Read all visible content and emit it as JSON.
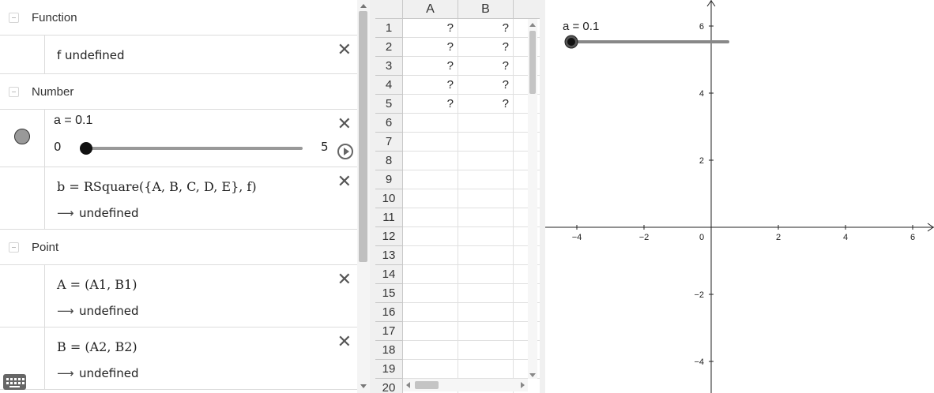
{
  "algebra": {
    "categories": {
      "function": "Function",
      "number": "Number",
      "point": "Point"
    },
    "f_row": {
      "expr": "f undefined"
    },
    "a_row": {
      "expr": "a = 0.1",
      "slider_min": "0",
      "slider_max": "5",
      "slider_value": 0.1
    },
    "b_row": {
      "expr": "b = RSquare({A, B, C, D, E}, f)",
      "output": "undefined"
    },
    "A_row": {
      "expr": "A = (A1, B1)",
      "output": "undefined"
    },
    "B_row": {
      "expr": "B = (A2, B2)",
      "output": "undefined"
    },
    "arrow": "⟶",
    "close": "✕"
  },
  "spreadsheet": {
    "columns": [
      "A",
      "B"
    ],
    "rows": [
      "1",
      "2",
      "3",
      "4",
      "5",
      "6",
      "7",
      "8",
      "9",
      "10",
      "11",
      "12",
      "13",
      "14",
      "15",
      "16",
      "17",
      "18",
      "19",
      "20"
    ],
    "cells": [
      [
        "?",
        "?"
      ],
      [
        "?",
        "?"
      ],
      [
        "?",
        "?"
      ],
      [
        "?",
        "?"
      ],
      [
        "?",
        "?"
      ],
      [
        "",
        ""
      ],
      [
        "",
        ""
      ],
      [
        "",
        ""
      ],
      [
        "",
        ""
      ],
      [
        "",
        ""
      ],
      [
        "",
        ""
      ],
      [
        "",
        ""
      ],
      [
        "",
        ""
      ],
      [
        "",
        ""
      ],
      [
        "",
        ""
      ],
      [
        "",
        ""
      ],
      [
        "",
        ""
      ],
      [
        "",
        ""
      ],
      [
        "",
        ""
      ],
      [
        "",
        ""
      ]
    ]
  },
  "graphics": {
    "slider_label": "a = 0.1",
    "slider_value": 0.1,
    "x_ticks": [
      "−4",
      "−2",
      "0",
      "2",
      "4",
      "6"
    ],
    "y_ticks": [
      "6",
      "4",
      "2",
      "−2",
      "−4"
    ]
  }
}
